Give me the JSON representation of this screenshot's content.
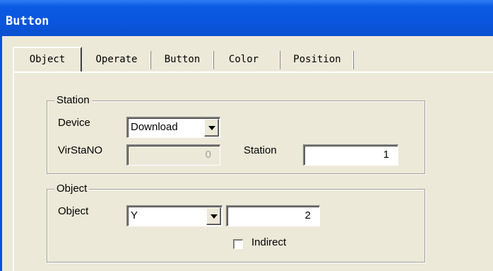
{
  "window": {
    "title": "Button"
  },
  "tabs": [
    {
      "label": "Object",
      "active": true
    },
    {
      "label": "Operate"
    },
    {
      "label": "Button"
    },
    {
      "label": "Color"
    },
    {
      "label": "Position"
    }
  ],
  "station_group": {
    "legend": "Station",
    "device_label": "Device",
    "device_value": "Download",
    "virstano_label": "VirStaNO",
    "virstano_value": "0",
    "station_label": "Station",
    "station_value": "1"
  },
  "object_group": {
    "legend": "Object",
    "object_label": "Object",
    "object_value": "Y",
    "number_value": "2",
    "indirect_label": "Indirect",
    "indirect_checked": false
  },
  "colors": {
    "titlebar": "#0a56dd",
    "dialog_bg": "#ece9d8"
  }
}
